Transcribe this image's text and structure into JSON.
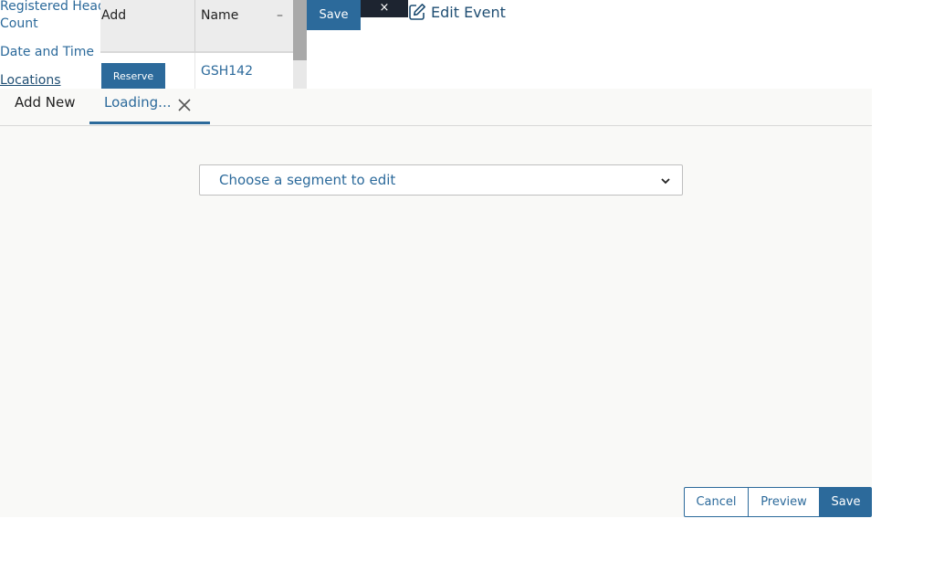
{
  "left_nav": {
    "registered_head_count_line1": "Registered Head",
    "registered_head_count_line2": "Count",
    "date_and_time": "Date and Time",
    "locations": "Locations"
  },
  "table": {
    "header_add": "Add",
    "header_name": "Name",
    "header_collapse": "–",
    "reserve_label": "Reserve",
    "row_name": "GSH142"
  },
  "top_bar": {
    "save_label": "Save",
    "close_glyph": "×",
    "edit_event_title": "Edit Event"
  },
  "tabs": {
    "add_new": "Add New",
    "loading": "Loading..."
  },
  "segment": {
    "placeholder": "Choose a segment to edit"
  },
  "footer": {
    "cancel_label": "Cancel",
    "preview_label": "Preview",
    "save_label": "Save"
  },
  "colors": {
    "accent": "#2c6a9b",
    "dark": "#1d2430",
    "panel_bg": "#f9f9f7"
  }
}
